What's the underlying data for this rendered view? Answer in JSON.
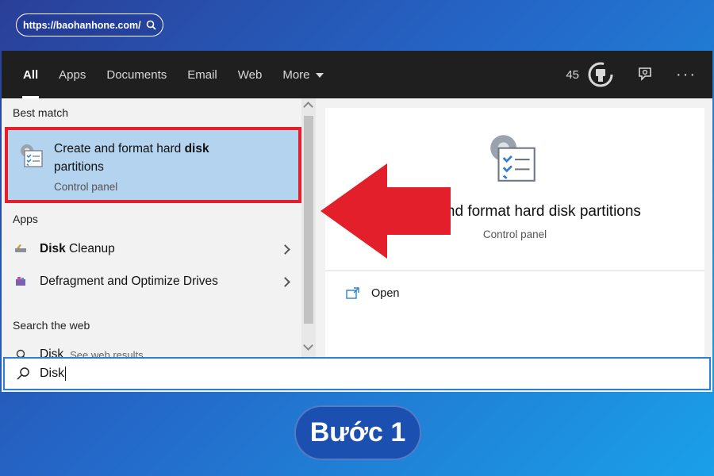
{
  "url_pill": {
    "text": "https://baohanhone.com/",
    "icon": "search-icon"
  },
  "topbar": {
    "tabs": [
      {
        "label": "All",
        "active": true
      },
      {
        "label": "Apps"
      },
      {
        "label": "Documents"
      },
      {
        "label": "Email"
      },
      {
        "label": "Web"
      },
      {
        "label": "More"
      }
    ],
    "points": "45",
    "icons": [
      "rewards-medal-icon",
      "feedback-icon",
      "more-options-icon"
    ],
    "more_options": "···"
  },
  "results": {
    "best_match_label": "Best match",
    "best_match": {
      "title_plain": "Create and format hard ",
      "title_bold": "disk",
      "title_rest": " partitions",
      "subtitle": "Control panel",
      "icon": "disk-management-icon"
    },
    "apps_label": "Apps",
    "apps": [
      {
        "bold": "Disk",
        "rest": " Cleanup",
        "icon": "disk-cleanup-icon"
      },
      {
        "bold": "",
        "rest": "Defragment and Optimize Drives",
        "icon": "defragment-icon"
      }
    ],
    "web_label": "Search the web",
    "web_item": {
      "label": "Disk",
      "hint": "See web results"
    }
  },
  "preview": {
    "title": "Create and format hard disk partitions",
    "subtitle": "Control panel",
    "open_label": "Open"
  },
  "search": {
    "value": "Disk"
  },
  "step_badge": "Bước 1",
  "colors": {
    "highlight": "#b3d3ee",
    "red_outline": "#e21f2a",
    "topbar": "#1f1f1f",
    "accent": "#2b7fd6"
  }
}
